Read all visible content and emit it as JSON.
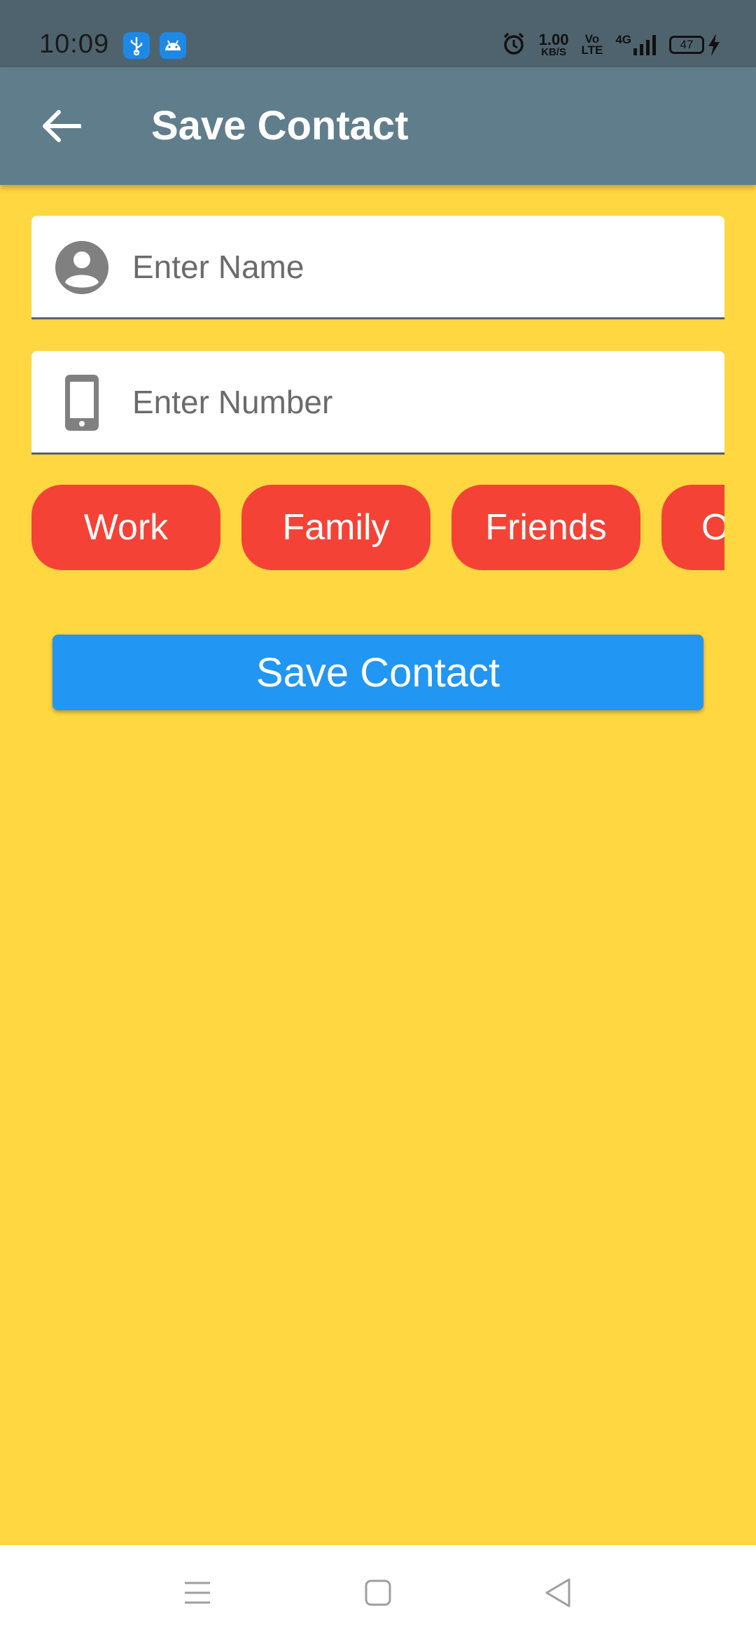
{
  "status_bar": {
    "time": "10:09",
    "net_speed_value": "1.00",
    "net_speed_unit": "KB/S",
    "volte_top": "Vo",
    "volte_bottom": "LTE",
    "network_type": "4G",
    "battery_level": "47",
    "icons": [
      "usb-icon",
      "android-icon",
      "alarm-icon",
      "signal-icon",
      "battery-icon",
      "charging-icon"
    ]
  },
  "app_bar": {
    "title": "Save Contact",
    "back_icon": "arrow-back-icon",
    "color": "#607D8B"
  },
  "form": {
    "name": {
      "placeholder": "Enter Name",
      "value": "",
      "icon": "account-circle-icon"
    },
    "number": {
      "placeholder": "Enter Number",
      "value": "",
      "icon": "phone-icon"
    }
  },
  "chips": [
    {
      "label": "Work"
    },
    {
      "label": "Family"
    },
    {
      "label": "Friends"
    },
    {
      "label": "Others"
    }
  ],
  "save_button": {
    "label": "Save Contact",
    "color": "#2196F3"
  },
  "colors": {
    "background": "#FFD740",
    "chip": "#F44336",
    "status_bar": "#4F636E"
  },
  "nav_bar": {
    "icons": [
      "menu-icon",
      "home-square-icon",
      "back-triangle-icon"
    ]
  }
}
